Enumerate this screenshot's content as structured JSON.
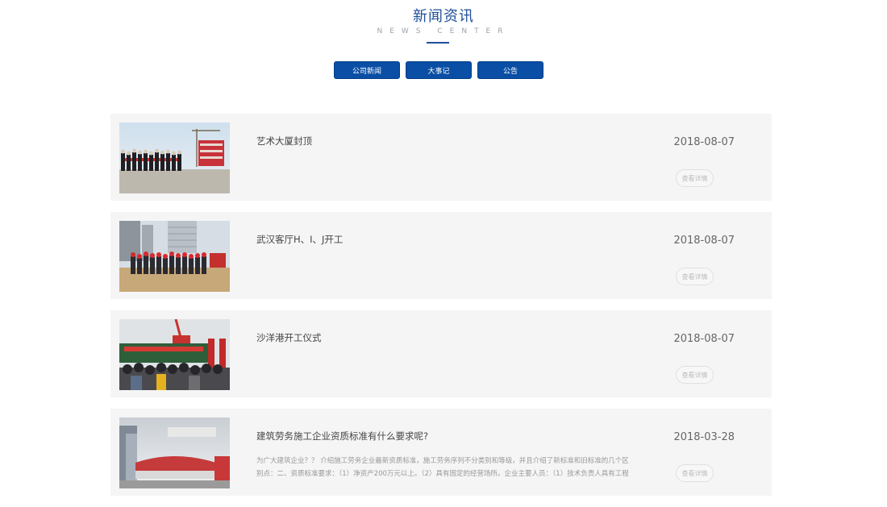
{
  "header": {
    "title": "新闻资讯",
    "subtitle": "NEWS CENTER"
  },
  "tabs": [
    {
      "label": "公司新闻"
    },
    {
      "label": "大事记"
    },
    {
      "label": "公告"
    }
  ],
  "news": [
    {
      "title": "艺术大厦封顶",
      "date": "2018-08-07",
      "detail_label": "查看详情",
      "summary": ""
    },
    {
      "title": "武汉客厅H、I、J开工",
      "date": "2018-08-07",
      "detail_label": "查看详情",
      "summary": ""
    },
    {
      "title": "沙洋港开工仪式",
      "date": "2018-08-07",
      "detail_label": "查看详情",
      "summary": ""
    },
    {
      "title": "建筑劳务施工企业资质标准有什么要求呢?",
      "date": "2018-03-28",
      "detail_label": "查看详情",
      "summary": "为广大建筑企业？？ 介绍施工劳务企业最新资质标准，施工劳务序列不分类别和等级，并且介绍了新标准和旧标准的几个区别点：二、资质标准要求：（1）净资产200万元以上。（2）具有固定的经营场所。企业主要人员：（1）技术负责人具有工程"
    }
  ],
  "colors": {
    "brand": "#1e4f9a",
    "tab_bg": "#0a4ea5",
    "card_bg": "#f5f5f5"
  }
}
